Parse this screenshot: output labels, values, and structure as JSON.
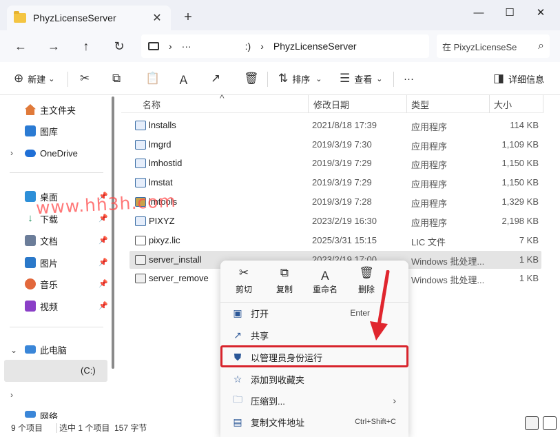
{
  "window": {
    "tab_title": "PhyzLicenseServer",
    "tab_close": "✕",
    "new_tab": "+",
    "minimize": "—",
    "maximize": "☐",
    "close": "✕"
  },
  "nav": {
    "back": "←",
    "forward": "→",
    "up": "↑",
    "refresh": "↻"
  },
  "address": {
    "sep1": "›",
    "ellipsis": "···",
    "drive_fragment": ":)",
    "sep2": "›",
    "folder": "PhyzLicenseServer",
    "search_placeholder": "在 PixyzLicenseSe",
    "search_icon": "⌕"
  },
  "toolbar": {
    "new": "新建",
    "sort": "排序",
    "view": "查看",
    "more": "···",
    "details": "详细信息",
    "icons": {
      "new": "⊕",
      "cut": "✂",
      "copy": "⧉",
      "paste": "📋",
      "rename": "Ａ",
      "share": "↗",
      "delete": "🗑",
      "sort": "⇅",
      "view": "☰",
      "details": "◨",
      "dropdown": "⌄"
    }
  },
  "sidebar": {
    "home": "主文件夹",
    "gallery": "图库",
    "onedrive": "OneDrive",
    "desktop": "桌面",
    "downloads": "下载",
    "documents": "文档",
    "pictures": "图片",
    "music": "音乐",
    "videos": "视频",
    "this_pc": "此电脑",
    "drive_c": "(C:)",
    "network": "网络",
    "pin": "📌",
    "caret_right": "›",
    "caret_down": "⌄"
  },
  "columns": {
    "name": "名称",
    "date": "修改日期",
    "type": "类型",
    "size": "大小",
    "sort_indicator": "^"
  },
  "files": [
    {
      "name": "lnstalls",
      "date": "2021/8/18 17:39",
      "type": "应用程序",
      "size": "114 KB",
      "icon": "exe"
    },
    {
      "name": "lmgrd",
      "date": "2019/3/19 7:30",
      "type": "应用程序",
      "size": "1,109 KB",
      "icon": "exe"
    },
    {
      "name": "lmhostid",
      "date": "2019/3/19 7:29",
      "type": "应用程序",
      "size": "1,150 KB",
      "icon": "exe"
    },
    {
      "name": "lmstat",
      "date": "2019/3/19 7:29",
      "type": "应用程序",
      "size": "1,150 KB",
      "icon": "exe"
    },
    {
      "name": "lmtools",
      "date": "2019/3/19 7:28",
      "type": "应用程序",
      "size": "1,329 KB",
      "icon": "exe"
    },
    {
      "name": "PIXYZ",
      "date": "2023/2/19 16:30",
      "type": "应用程序",
      "size": "2,198 KB",
      "icon": "exe"
    },
    {
      "name": "pixyz.lic",
      "date": "2025/3/31 15:15",
      "type": "LIC 文件",
      "size": "7 KB",
      "icon": "doc"
    },
    {
      "name": "server_install",
      "date": "2023/2/19 17:00",
      "type": "Windows 批处理...",
      "size": "1 KB",
      "icon": "bat"
    },
    {
      "name": "server_remove",
      "date": "",
      "type": "Windows 批处理...",
      "size": "1 KB",
      "icon": "bat"
    }
  ],
  "status": {
    "count": "9 个项目",
    "selected": "选中 1 个项目",
    "size": "157 字节"
  },
  "context_menu": {
    "quick": {
      "cut": "剪切",
      "copy": "复制",
      "rename": "重命名",
      "delete": "删除",
      "cut_icon": "✂",
      "copy_icon": "⧉",
      "rename_icon": "Ａ",
      "delete_icon": "🗑"
    },
    "open": "打开",
    "open_shortcut": "Enter",
    "share": "共享",
    "run_as_admin": "以管理员身份运行",
    "add_favorites": "添加到收藏夹",
    "compress": "压缩到...",
    "copy_path": "复制文件地址",
    "copy_path_shortcut": "Ctrl+Shift+C",
    "submenu_arrow": "›",
    "icons": {
      "open": "▣",
      "share": "↗",
      "admin": "⛊",
      "favorite": "☆",
      "compress": "🗀",
      "path": "▤"
    }
  },
  "watermark": "www.hh3h.com",
  "colors": {
    "accent": "#0067c0",
    "highlight_border": "#d8242c",
    "arrow": "#e0262e",
    "selection": "#e4e4e4"
  }
}
